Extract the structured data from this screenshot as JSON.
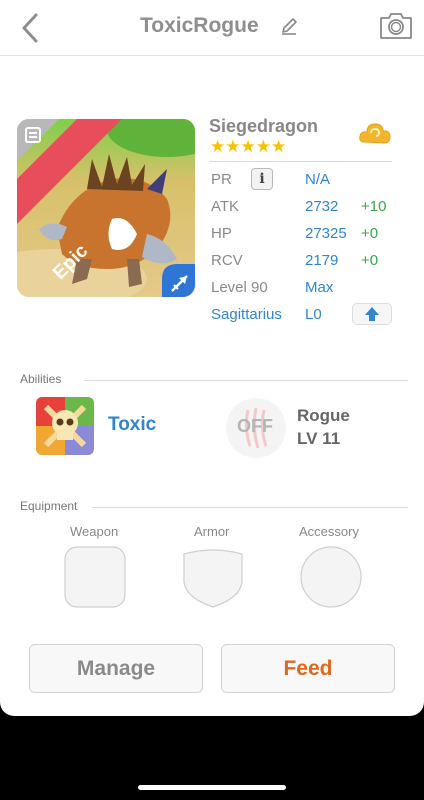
{
  "header": {
    "title": "ToxicRogue",
    "back_icon": "chevron-left-icon",
    "edit_icon": "pencil-icon",
    "camera_icon": "camera-icon"
  },
  "dragon": {
    "name": "Siegedragon",
    "rarity": "Epic",
    "stars": "★★★★★",
    "star_count": 5,
    "element_icon": "cloud-icon",
    "class_icon": "sniper-arrow-icon",
    "stats": [
      {
        "label": "PR",
        "value": "N/A",
        "bonus": ""
      },
      {
        "label": "ATK",
        "value": "2732",
        "bonus": "+10"
      },
      {
        "label": "HP",
        "value": "27325",
        "bonus": "+0"
      },
      {
        "label": "RCV",
        "value": "2179",
        "bonus": "+0"
      },
      {
        "label": "Level 90",
        "value": "Max",
        "bonus": ""
      },
      {
        "label": "Sagittarius",
        "value": "L0",
        "bonus": ""
      }
    ]
  },
  "abilities": {
    "section_label": "Abilities",
    "ability_name": "Toxic",
    "trait_status": "OFF",
    "trait_name": "Rogue",
    "trait_level": "LV 11"
  },
  "equipment": {
    "section_label": "Equipment",
    "slots": [
      {
        "label": "Weapon"
      },
      {
        "label": "Armor"
      },
      {
        "label": "Accessory"
      }
    ]
  },
  "actions": {
    "manage": "Manage",
    "feed": "Feed"
  },
  "colors": {
    "accent_blue": "#2f85d4",
    "bonus_green": "#3aa64a",
    "feed_orange": "#e0681e",
    "star_gold": "#f4c200",
    "epic_red": "#e84d5b"
  }
}
